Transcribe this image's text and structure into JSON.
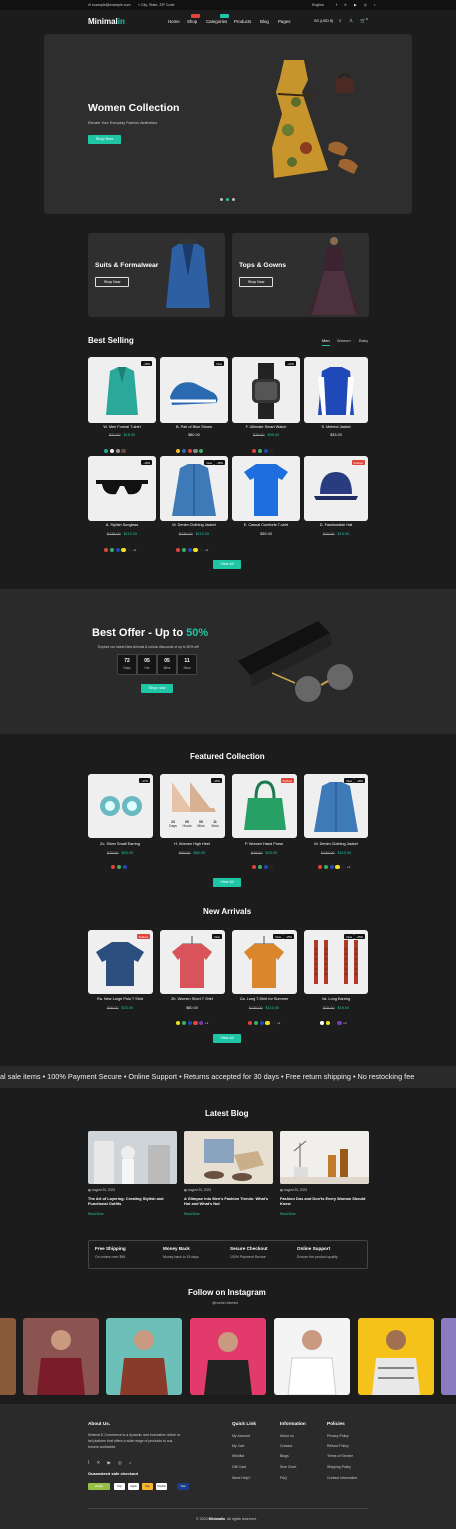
{
  "topbar": {
    "email": "example@example.com",
    "address": "City, State, ZIP Code",
    "language": "English",
    "socials": [
      "facebook-icon",
      "twitter-icon",
      "youtube-icon",
      "instagram-icon",
      "tiktok-icon"
    ]
  },
  "nav": {
    "logo_main": "Minimal",
    "logo_accent": "in",
    "links": [
      "Home",
      "Shop",
      "Categories",
      "Products",
      "Blog",
      "Pages"
    ],
    "currency": "SG (USD $)",
    "cart_count": "0",
    "accent": "#1fc6a6"
  },
  "hero": {
    "title": "Women Collection",
    "subtitle": "Elevate Your Everyday Fashion Aesthetics",
    "button": "Shop Now"
  },
  "categories": [
    {
      "title": "Suits & Formalwear",
      "button": "Shop Now"
    },
    {
      "title": "Tops & Gowns",
      "button": "Shop Now"
    }
  ],
  "best_selling": {
    "title": "Best Selling",
    "tabs": [
      "Men",
      "Women",
      "Baby"
    ],
    "products": [
      {
        "badge": "-18%",
        "name": "W. Men Formal T-shirt",
        "old": "$21.00",
        "price": "$18.00"
      },
      {
        "badge": "New",
        "name": "B. Pair of Blue Shoes",
        "old": "",
        "price": "$80.00"
      },
      {
        "badge": "-22%",
        "name": "F. Ultimate Smart Watch",
        "old": "$76.00",
        "price": "$59.00"
      },
      {
        "badge": "",
        "name": "S. Melend Jacket",
        "old": "",
        "price": "$33.00"
      },
      {
        "badge": "-18%",
        "name": "A. Stylish Sunglass",
        "old": "$138.00",
        "price": "$110.00"
      },
      {
        "badge": "-18%",
        "name": "M. Denim Clothing Jacket",
        "old": "$136.00",
        "price": "$110.00"
      },
      {
        "badge": "",
        "name": "E. Casual Comforts T-shirt",
        "old": "",
        "price": "$39.00"
      },
      {
        "badge": "Soldout",
        "name": "D. Fashionable Hat",
        "old": "$20.00",
        "price": "$15.00"
      }
    ],
    "button": "View All"
  },
  "offer": {
    "title": "Best Offer - Up to ",
    "title_accent": "50%",
    "subtitle": "Explore our latest New Arrivals & unlock discounts of up to 50% off!",
    "countdown": [
      {
        "n": "72",
        "l": "Days"
      },
      {
        "n": "05",
        "l": "Hrs"
      },
      {
        "n": "05",
        "l": "Mins"
      },
      {
        "n": "11",
        "l": "Secs"
      }
    ],
    "button": "Shop now"
  },
  "featured": {
    "title": "Featured Collection",
    "products": [
      {
        "badge": "-17%",
        "name": "Zc. Silver Small Earring",
        "old": "$75.00",
        "price": "$55.00"
      },
      {
        "badge": "-15%",
        "name": "H. Women High Heel",
        "old": "",
        "price": "$80.00"
      },
      {
        "badge": "Soldout",
        "name": "P. Women Hand Purse",
        "old": "$38.00",
        "price": "$33.00"
      },
      {
        "badge": "-18%",
        "name": "M. Denim Clothing Jacket",
        "old": "$136.00",
        "price": "$110.00"
      }
    ],
    "mini_countdown": [
      {
        "n": "23",
        "l": "Days"
      },
      {
        "n": "05",
        "l": "Hours"
      },
      {
        "n": "05",
        "l": "Mins"
      },
      {
        "n": "11",
        "l": "Secs"
      }
    ],
    "button": "View All"
  },
  "arrivals": {
    "title": "New Arrivals",
    "products": [
      {
        "badge": "Soldout",
        "name": "Ra. New Large Polo T Shirt",
        "old": "",
        "price": "$36.00",
        "price2": "$33.00"
      },
      {
        "badge": "New",
        "name": "Zb. Women Short T Shirt",
        "old": "",
        "price": "$80.00"
      },
      {
        "badge": "-15%",
        "name": "Ca. Long T-Shirt for Summer",
        "old": "$130.00",
        "price": "$110.00"
      },
      {
        "badge": "-25%",
        "name": "Va. Long Earring",
        "old": "$25.00",
        "price": "$19.00"
      }
    ],
    "button": "View All"
  },
  "marquee": "al sale items  •  100% Payment Secure  •  Online Support  •  Returns accepted for 30 days  •  Free return shipping  •  No restocking fee",
  "blog": {
    "title": "Latest Blog",
    "posts": [
      {
        "date": "August 20, 2023",
        "title": "The Art of Layering: Creating Stylish and Functional Outfits",
        "more": "Read More"
      },
      {
        "date": "August 20, 2023",
        "title": "A Glimpse into Men's Fashion Trends: What's Hot and What's Not",
        "more": "Read More"
      },
      {
        "date": "August 20, 2023",
        "title": "Fashion Dos and Don'ts Every Woman Should Know",
        "more": "Read More"
      }
    ]
  },
  "features": [
    {
      "title": "Free Shipping",
      "sub": "On orders over $99."
    },
    {
      "title": "Money Back",
      "sub": "Money back in 15 days"
    },
    {
      "title": "Secure Checkout",
      "sub": "100% Payment Secure"
    },
    {
      "title": "Online Support",
      "sub": "Ensure the product quality"
    }
  ],
  "instagram": {
    "title": "Follow on Instagram",
    "handle": "@norton-themes"
  },
  "footer": {
    "about_title": "About Us.",
    "about_text": [
      "Minimal E-Commerce is a dynamic and innovative online re-",
      "tail platform that offers a wide range of products to cus-",
      "tomers worldwide."
    ],
    "checkout_title": "Guaranteed safe checkout",
    "payments": [
      "shopify",
      "Pay",
      "Apple",
      "Pay",
      "PayPal",
      "Visa"
    ],
    "cols": [
      {
        "title": "Quick Link",
        "links": [
          "My Account",
          "My Cart",
          "Wishlist",
          "Gift Card",
          "Need Help?"
        ]
      },
      {
        "title": "Information",
        "links": [
          "About us",
          "Contact",
          "Blogs",
          "Size Chart",
          "FAQ"
        ]
      },
      {
        "title": "Policies",
        "links": [
          "Privacy Policy",
          "Refund Policy",
          "Terms of Service",
          "Shipping Policy",
          "Contact information"
        ]
      }
    ],
    "copyright": "© 2023 ",
    "copyright_brand": "Minimalin",
    "copyright_end": ". All rights reserved."
  }
}
